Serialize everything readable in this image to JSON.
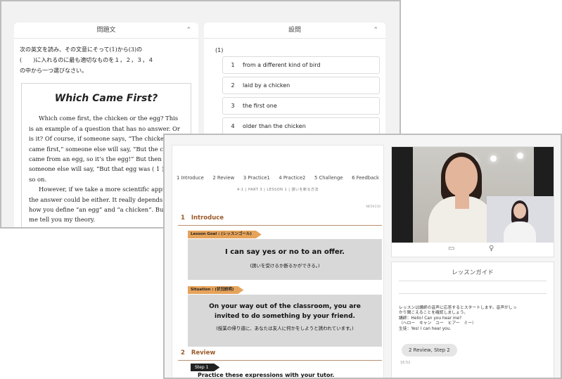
{
  "test": {
    "passage_header": "問題文",
    "question_header": "設問",
    "collapse_glyph": "⌃",
    "instruction_lines": [
      "次の英文を読み、その文意にそって(1)から(3)の",
      "(　　)に入れるのに最も適切なものを１，２，３，４",
      "の中から一つ選びなさい。"
    ],
    "passage_title": "Which Came First?",
    "paragraph1": "Which come first, the chicken or the egg? This is an example of a question that has no answer. Or is it? Of course, if someone says, “The chicken came first,” someone else will say, “But the chicken came from an egg, so it’s the egg!” But then someone else will say, “But that egg was ( 1 )!” And so on.",
    "paragraph2": "However, if we take a more scientific approach, the answer could be either. It really depends on how you define “an egg” and “a chicken”. But let me tell you my theory.",
    "question_number": "(1)",
    "choices": [
      {
        "num": "1",
        "text": "from a different kind of bird"
      },
      {
        "num": "2",
        "text": "laid by a chicken"
      },
      {
        "num": "3",
        "text": "the first one"
      },
      {
        "num": "4",
        "text": "older than the chicken"
      }
    ]
  },
  "lesson": {
    "tabs": [
      "1 Introduce",
      "2 Review",
      "3 Practice1",
      "4 Practice2",
      "5 Challenge",
      "6 Feedback"
    ],
    "breadcrumb": "4-1 | PART 3 | LESSON 1 | 誘いを断る方法",
    "code": "NE50150",
    "section1_num": "1",
    "section1_title": "Introduce",
    "goal_tag": "Lesson Goal : (レッスンゴール)",
    "goal_main": "I can say yes or no to an offer.",
    "goal_sub": "(誘いを受けるか断るかができる。)",
    "situation_tag": "Situation : (状況説明)",
    "situation_line1": "On your way out of the classroom, you are",
    "situation_line2": "invited to do something by your friend.",
    "situation_sub": "(授業の帰り道に、あなたは友人に何かをしようと誘われています。)",
    "section2_num": "2",
    "section2_title": "Review",
    "step_tag": "Step 1",
    "step_text": "Practice these expressions with your tutor."
  },
  "video": {
    "camera_icon_glyph": "▭",
    "mic_icon_glyph": "♀"
  },
  "guide": {
    "title": "レッスンガイド",
    "line1": "レッスンは講師の音声に応答するとスタートします。音声がしっ",
    "line2": "かり聞こえることを確認しましょう。",
    "line3": "講師：Hello! Can you hear me?",
    "line4": "（ヘロー　キャン　ユー　ヒアー　ミー）",
    "line5": "生徒：Yes! I can hear you.",
    "bubble": "2 Review, Step 2",
    "time": "16:52"
  }
}
